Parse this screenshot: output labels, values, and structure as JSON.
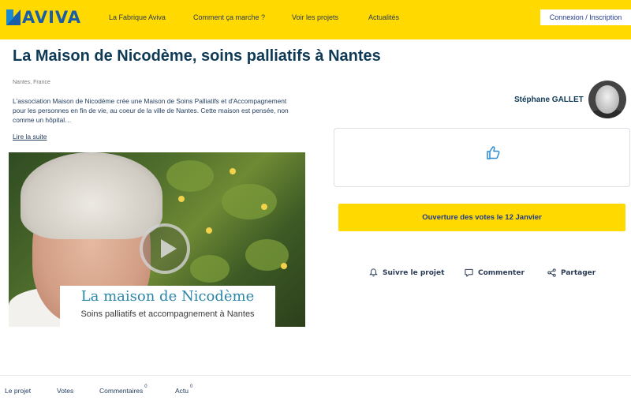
{
  "header": {
    "logo_text": "AVIVA",
    "nav": [
      "La Fabrique Aviva",
      "Comment ça marche ?",
      "Voir les projets",
      "Actualités"
    ],
    "login_label": "Connexion / Inscription"
  },
  "project": {
    "title": "La Maison de Nicodème, soins palliatifs à Nantes",
    "location": "Nantes, France",
    "description": "L'association Maison de Nicodème crée une Maison de Soins Palliatifs et d'Accompagnement pour les personnes en fin de vie, au coeur de la ville de Nantes. Cette maison est pensée, non comme un hôpital…",
    "read_more": "Lire la suite"
  },
  "video": {
    "caption_title": "La maison de Nicodème",
    "caption_subtitle": "Soins palliatifs et accompagnement à Nantes"
  },
  "author": {
    "name": "Stéphane GALLET"
  },
  "vote": {
    "cta_label": "Ouverture des votes le 12 Janvier"
  },
  "actions": {
    "follow": "Suivre le projet",
    "comment": "Commenter",
    "share": "Partager"
  },
  "tabs": [
    {
      "label": "Le projet",
      "count": ""
    },
    {
      "label": "Votes",
      "count": ""
    },
    {
      "label": "Commentaires",
      "count": "0"
    },
    {
      "label": "Actu",
      "count": "0"
    }
  ],
  "colors": {
    "accent_yellow": "#ffd900",
    "brand_blue": "#1a5da8",
    "title_dark": "#0f3a56"
  }
}
